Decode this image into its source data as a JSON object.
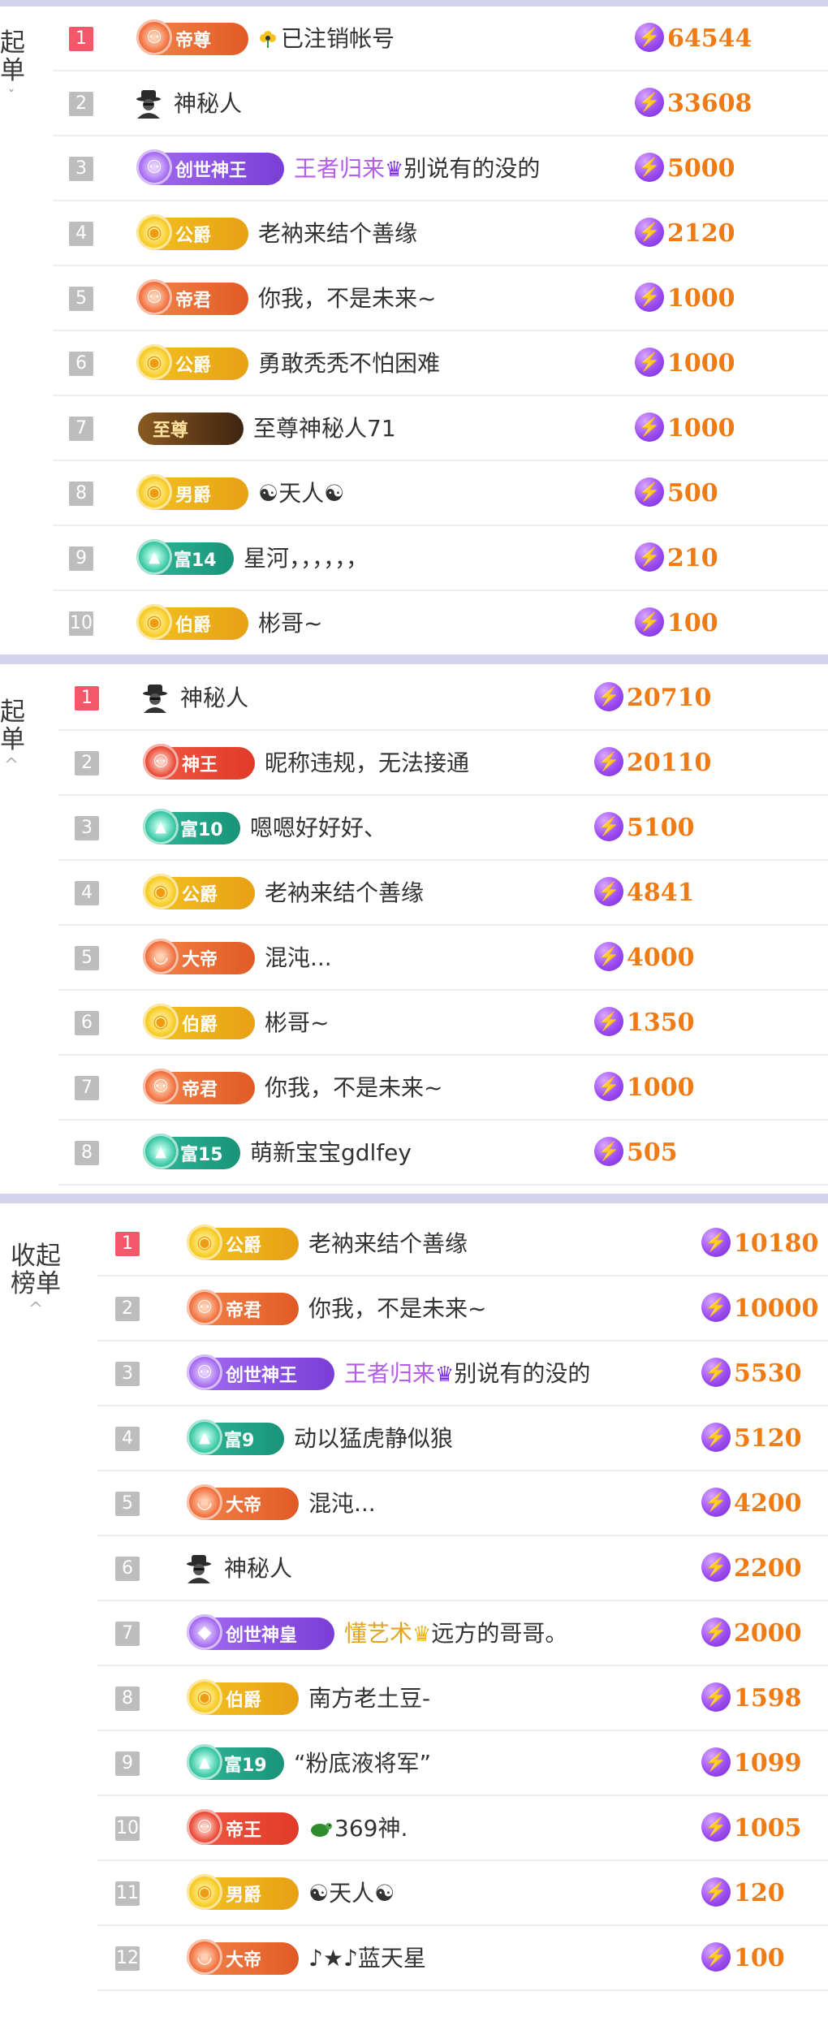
{
  "panels": [
    {
      "side_label_1": "起",
      "side_label_2": "单",
      "rows": [
        {
          "rank": "1",
          "badge": "帝尊",
          "badge_style": "orange",
          "badge_icon": "⚇",
          "name": "已注销帐号",
          "name_prefix_icon": "flower-icon",
          "score": "64544"
        },
        {
          "rank": "2",
          "badge": "",
          "badge_style": "hat",
          "name": "神秘人",
          "score": "33608"
        },
        {
          "rank": "3",
          "badge": "创世神王",
          "badge_style": "purple",
          "badge_icon": "⚇",
          "name_purple": "王者归来",
          "crown": "♛",
          "crown_style": "violet",
          "name": "别说有的没的",
          "score": "5000"
        },
        {
          "rank": "4",
          "badge": "公爵",
          "badge_style": "gold",
          "badge_icon": "◉",
          "name": "老衲来结个善缘",
          "score": "2120"
        },
        {
          "rank": "5",
          "badge": "帝君",
          "badge_style": "orange",
          "badge_icon": "⚇",
          "name": "你我，不是未来~",
          "score": "1000"
        },
        {
          "rank": "6",
          "badge": "公爵",
          "badge_style": "gold",
          "badge_icon": "◉",
          "name": "勇敢秃秃不怕困难",
          "score": "1000"
        },
        {
          "rank": "7",
          "badge": "至尊",
          "badge_style": "dark",
          "badge_icon": "",
          "name": "至尊神秘人71",
          "score": "1000"
        },
        {
          "rank": "8",
          "badge": "男爵",
          "badge_style": "gold",
          "badge_icon": "◉",
          "name": "☯天人☯",
          "score": "500"
        },
        {
          "rank": "9",
          "badge": "富14",
          "badge_style": "teal",
          "badge_icon": "▲",
          "name": "星河，，，，，，",
          "score": "210"
        },
        {
          "rank": "10",
          "badge": "伯爵",
          "badge_style": "gold",
          "badge_icon": "◉",
          "name": "彬哥~",
          "score": "100"
        }
      ]
    },
    {
      "side_label_1": "起",
      "side_label_2": "单",
      "caret": "^",
      "rows": [
        {
          "rank": "1",
          "badge": "",
          "badge_style": "hat",
          "name": "神秘人",
          "score": "20710"
        },
        {
          "rank": "2",
          "badge": "神王",
          "badge_style": "red",
          "badge_icon": "⚇",
          "name": "昵称违规，无法接通",
          "score": "20110"
        },
        {
          "rank": "3",
          "badge": "富10",
          "badge_style": "teal",
          "badge_icon": "▲",
          "name": "嗯嗯好好好、",
          "score": "5100"
        },
        {
          "rank": "4",
          "badge": "公爵",
          "badge_style": "gold",
          "badge_icon": "◉",
          "name": "老衲来结个善缘",
          "score": "4841"
        },
        {
          "rank": "5",
          "badge": "大帝",
          "badge_style": "orange",
          "badge_icon": "◡",
          "name": "混沌...",
          "score": "4000"
        },
        {
          "rank": "6",
          "badge": "伯爵",
          "badge_style": "gold",
          "badge_icon": "◉",
          "name": "彬哥~",
          "score": "1350"
        },
        {
          "rank": "7",
          "badge": "帝君",
          "badge_style": "orange",
          "badge_icon": "⚇",
          "name": "你我，不是未来~",
          "score": "1000"
        },
        {
          "rank": "8",
          "badge": "富15",
          "badge_style": "teal",
          "badge_icon": "▲",
          "name": "萌新宝宝gdlfey",
          "score": "505"
        }
      ]
    },
    {
      "side_label_1": "收起",
      "side_label_2": "榜单",
      "caret": "^",
      "rows": [
        {
          "rank": "1",
          "badge": "公爵",
          "badge_style": "gold",
          "badge_icon": "◉",
          "name": "老衲来结个善缘",
          "score": "10180"
        },
        {
          "rank": "2",
          "badge": "帝君",
          "badge_style": "orange",
          "badge_icon": "⚇",
          "name": "你我，不是未来~",
          "score": "10000"
        },
        {
          "rank": "3",
          "badge": "创世神王",
          "badge_style": "purple",
          "badge_icon": "⚇",
          "name_purple": "王者归来",
          "crown": "♛",
          "crown_style": "violet",
          "name": "别说有的没的",
          "score": "5530"
        },
        {
          "rank": "4",
          "badge": "富9",
          "badge_style": "teal",
          "badge_icon": "▲",
          "name": "动以猛虎静似狼",
          "score": "5120"
        },
        {
          "rank": "5",
          "badge": "大帝",
          "badge_style": "orange",
          "badge_icon": "◡",
          "name": "混沌...",
          "score": "4200"
        },
        {
          "rank": "6",
          "badge": "",
          "badge_style": "hat",
          "name": "神秘人",
          "score": "2200"
        },
        {
          "rank": "7",
          "badge": "创世神皇",
          "badge_style": "purple",
          "badge_icon": "◆",
          "name_gold": "懂艺术",
          "crown": "♛",
          "crown_style": "amber",
          "name": "远方的哥哥。",
          "score": "2000"
        },
        {
          "rank": "8",
          "badge": "伯爵",
          "badge_style": "gold",
          "badge_icon": "◉",
          "name": "南方老土豆-",
          "score": "1598"
        },
        {
          "rank": "9",
          "badge": "富19",
          "badge_style": "teal",
          "badge_icon": "▲",
          "name": "“粉底液将军”",
          "score": "1099"
        },
        {
          "rank": "10",
          "badge": "帝王",
          "badge_style": "red",
          "badge_icon": "⚇",
          "name": "369神.",
          "name_prefix_icon": "turtle-icon",
          "score": "1005"
        },
        {
          "rank": "11",
          "badge": "男爵",
          "badge_style": "gold",
          "badge_icon": "◉",
          "name": "☯天人☯",
          "score": "120"
        },
        {
          "rank": "12",
          "badge": "大帝",
          "badge_style": "orange",
          "badge_icon": "◡",
          "name": "♪★♪蓝天星",
          "score": "100"
        }
      ]
    }
  ],
  "colors": {
    "rank_first": "#f4566a",
    "rank_other": "#bdbdbd",
    "score": "#f07a14",
    "band": "#d4d1ed",
    "purple_name": "#b25ee6",
    "gold_name": "#e1a320"
  }
}
